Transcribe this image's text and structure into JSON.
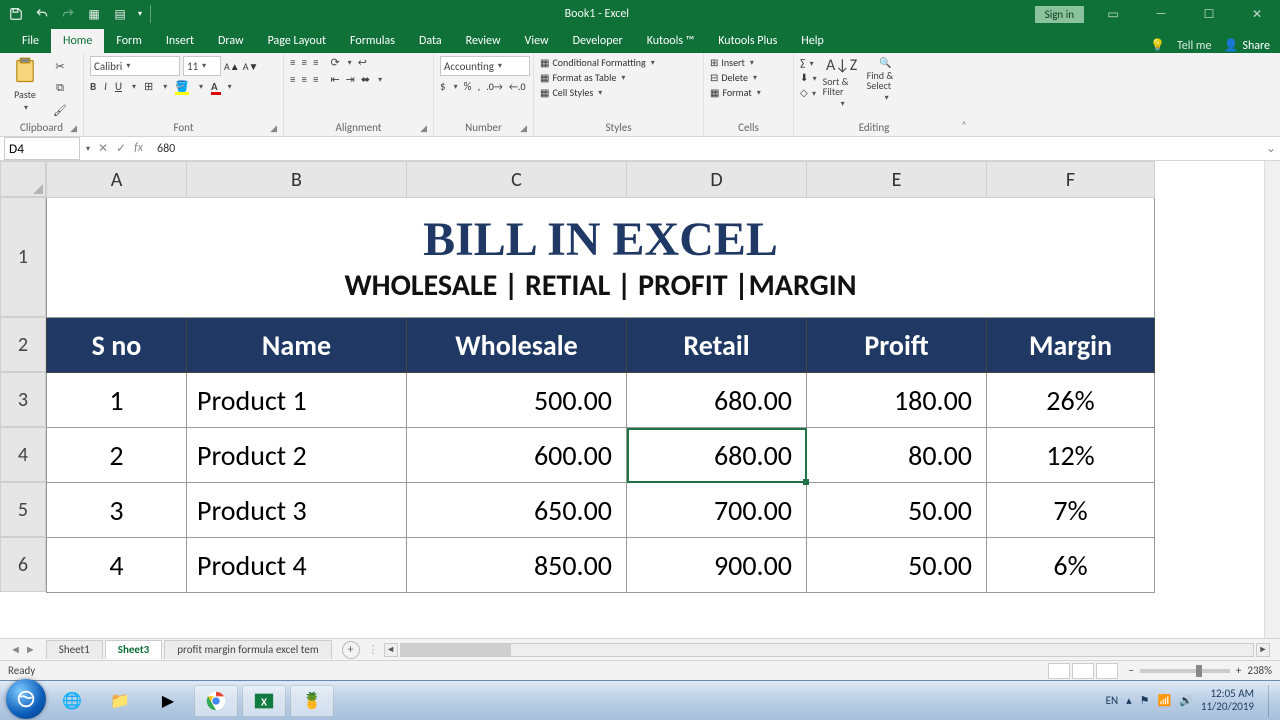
{
  "title": "Book1 - Excel",
  "signin": "Sign in",
  "tabs": [
    "File",
    "Home",
    "Form",
    "Insert",
    "Draw",
    "Page Layout",
    "Formulas",
    "Data",
    "Review",
    "View",
    "Developer",
    "Kutools ™",
    "Kutools Plus",
    "Help"
  ],
  "tellme": "Tell me",
  "share": "Share",
  "ribbon": {
    "clipboard": {
      "label": "Clipboard",
      "paste": "Paste"
    },
    "font": {
      "label": "Font",
      "name": "Calibri",
      "size": "11"
    },
    "alignment": {
      "label": "Alignment",
      "wrap": "Wrap Text",
      "merge": "Merge & Center"
    },
    "number": {
      "label": "Number",
      "format": "Accounting"
    },
    "styles": {
      "label": "Styles",
      "cond": "Conditional Formatting",
      "table": "Format as Table",
      "cell": "Cell Styles"
    },
    "cells": {
      "label": "Cells",
      "insert": "Insert",
      "delete": "Delete",
      "format": "Format"
    },
    "editing": {
      "label": "Editing",
      "sort": "Sort & Filter",
      "find": "Find & Select"
    }
  },
  "namebox": "D4",
  "formula": "680",
  "columns": [
    "A",
    "B",
    "C",
    "D",
    "E",
    "F"
  ],
  "rows": [
    "1",
    "2",
    "3",
    "4",
    "5",
    "6"
  ],
  "sheet": {
    "title": "BILL IN EXCEL",
    "subtitle": "WHOLESALE | RETIAL | PROFIT |MARGIN",
    "headers": [
      "S no",
      "Name",
      "Wholesale",
      "Retail",
      "Proift",
      "Margin"
    ],
    "data": [
      {
        "sno": "1",
        "name": "Product 1",
        "wholesale": "500.00",
        "retail": "680.00",
        "profit": "180.00",
        "margin": "26%"
      },
      {
        "sno": "2",
        "name": "Product 2",
        "wholesale": "600.00",
        "retail": "680.00",
        "profit": "80.00",
        "margin": "12%"
      },
      {
        "sno": "3",
        "name": "Product 3",
        "wholesale": "650.00",
        "retail": "700.00",
        "profit": "50.00",
        "margin": "7%"
      },
      {
        "sno": "4",
        "name": "Product 4",
        "wholesale": "850.00",
        "retail": "900.00",
        "profit": "50.00",
        "margin": "6%"
      }
    ]
  },
  "sheettabs": [
    "Sheet1",
    "Sheet3",
    "profit margin formula excel tem"
  ],
  "active_sheet": "Sheet3",
  "status": {
    "ready": "Ready",
    "zoom": "238%"
  },
  "tray": {
    "lang": "EN",
    "time": "12:05 AM",
    "date": "11/20/2019"
  }
}
